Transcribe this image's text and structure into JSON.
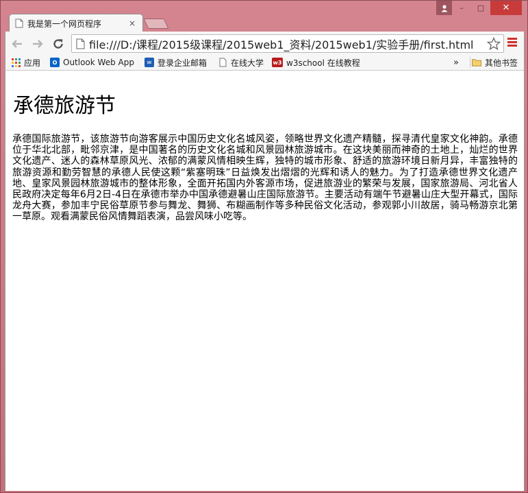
{
  "window": {
    "caption": {
      "minimize": "–",
      "maximize": "□",
      "close": "✕"
    }
  },
  "tab": {
    "title": "我是第一个网页程序",
    "close": "×"
  },
  "toolbar": {
    "url": "file:///D:/课程/2015级课程/2015web1_资料/2015web1/实验手册/first.html",
    "back_icon": "back-arrow-icon",
    "forward_icon": "forward-arrow-icon",
    "reload_icon": "reload-icon",
    "star_icon": "star-icon",
    "menu_icon": "hamburger-menu-icon"
  },
  "bookmarks": {
    "items": [
      {
        "label": "应用",
        "icon": "apps-grid-icon"
      },
      {
        "label": "Outlook Web App",
        "icon": "outlook-icon"
      },
      {
        "label": "登录企业邮箱",
        "icon": "mail-icon"
      },
      {
        "label": "在线大学",
        "icon": "page-icon"
      },
      {
        "label": "w3school 在线教程",
        "icon": "w3school-icon"
      }
    ],
    "overflow": "»",
    "other": {
      "label": "其他书签",
      "icon": "folder-icon"
    }
  },
  "page": {
    "heading": "承德旅游节",
    "paragraph": "承德国际旅游节，该旅游节向游客展示中国历史文化名城风姿，领略世界文化遗产精髓，探寻清代皇家文化神韵。承德位于华北北部，毗邻京津，是中国著名的历史文化名城和风景园林旅游城市。在这块美丽而神奇的土地上，灿烂的世界文化遗产、迷人的森林草原风光、浓郁的满蒙风情相映生辉，独特的城市形象、舒适的旅游环境日新月异，丰富独特的旅游资源和勤劳智慧的承德人民使这颗“紫塞明珠”日益焕发出熠熠的光辉和诱人的魅力。为了打造承德世界文化遗产地、皇家风景园林旅游城市的整体形象，全面开拓国内外客源市场，促进旅游业的繁荣与发展，国家旅游局、河北省人民政府决定每年6月2日-4日在承德市举办中国承德避暑山庄国际旅游节。主要活动有端午节避暑山庄大型开幕式，国际龙舟大赛，参加丰宁民俗草原节参与舞龙、舞狮、布糊画制作等多种民俗文化活动，参观郭小川故居，骑马畅游京北第一草原。观看满蒙民俗风情舞蹈表演，品尝风味小吃等。"
  }
}
